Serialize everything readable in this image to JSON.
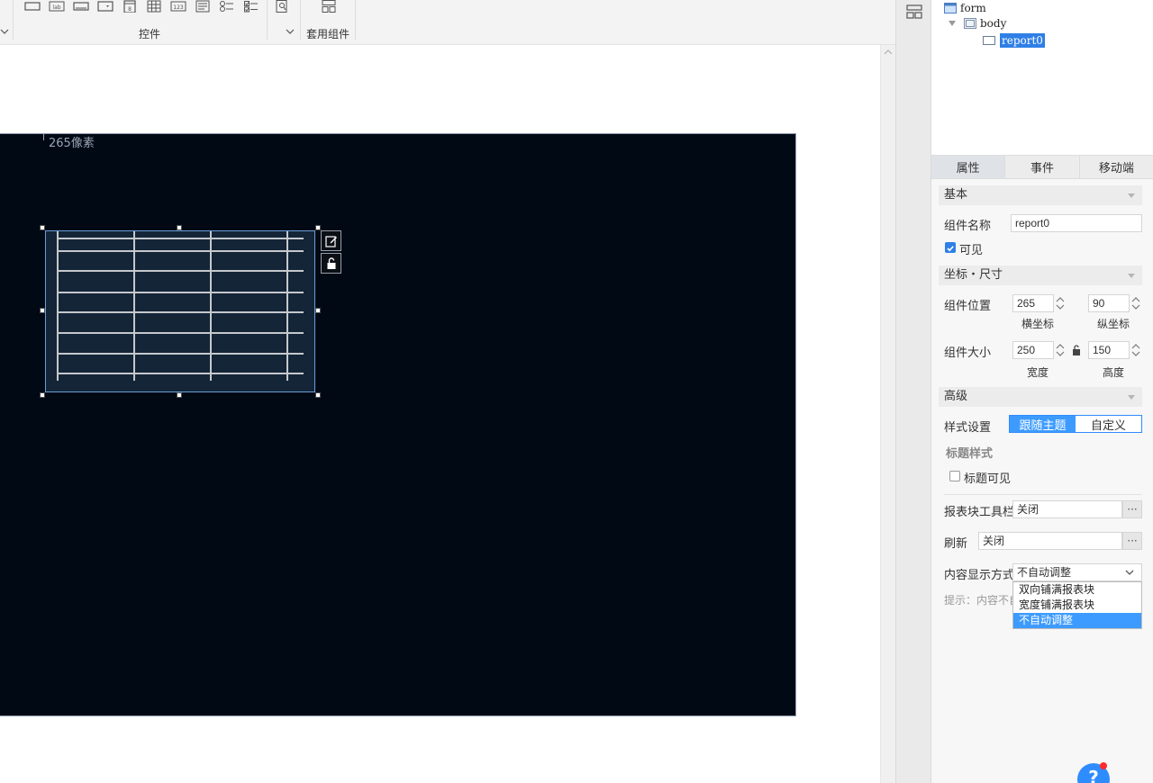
{
  "toolbar": {
    "group_controls": "控件",
    "group_templates": "套用组件",
    "icons": [
      "textbox-icon",
      "label-icon",
      "button-icon",
      "combobox-icon",
      "date-icon",
      "grid-icon",
      "number-icon",
      "textarea-icon",
      "radiogroup-icon",
      "checkboxgroup-icon",
      "preview-icon"
    ]
  },
  "canvas": {
    "position_hint": "265像素"
  },
  "tree": {
    "root": "form",
    "body": "body",
    "selected": "report0"
  },
  "tabs": [
    "属性",
    "事件",
    "移动端"
  ],
  "props": {
    "basic_section": "基本",
    "component_name_label": "组件名称",
    "component_name_value": "report0",
    "visible_label": "可见",
    "visible_checked": true,
    "coords_section": "坐标・尺寸",
    "position_label": "组件位置",
    "pos_x": "265",
    "pos_y": "90",
    "x_label": "横坐标",
    "y_label": "纵坐标",
    "size_label": "组件大小",
    "width": "250",
    "height": "150",
    "width_label": "宽度",
    "height_label": "高度",
    "advanced_section": "高级",
    "style_label": "样式设置",
    "style_follow_theme": "跟随主题",
    "style_custom": "自定义",
    "title_style_label": "标题样式",
    "title_visible_label": "标题可见",
    "title_visible_checked": false,
    "toolbar_label": "报表块工具栏",
    "toolbar_value": "关闭",
    "refresh_label": "刷新",
    "refresh_value": "关闭",
    "content_display_label": "内容显示方式",
    "content_display_value": "不自动调整",
    "content_display_options": [
      "双向铺满报表块",
      "宽度铺满报表块",
      "不自动调整"
    ],
    "tip_text": "提示：内容不自"
  },
  "help": {
    "label": "?"
  },
  "colors": {
    "canvas_bg": "#010915",
    "accent": "#3d9bff"
  }
}
